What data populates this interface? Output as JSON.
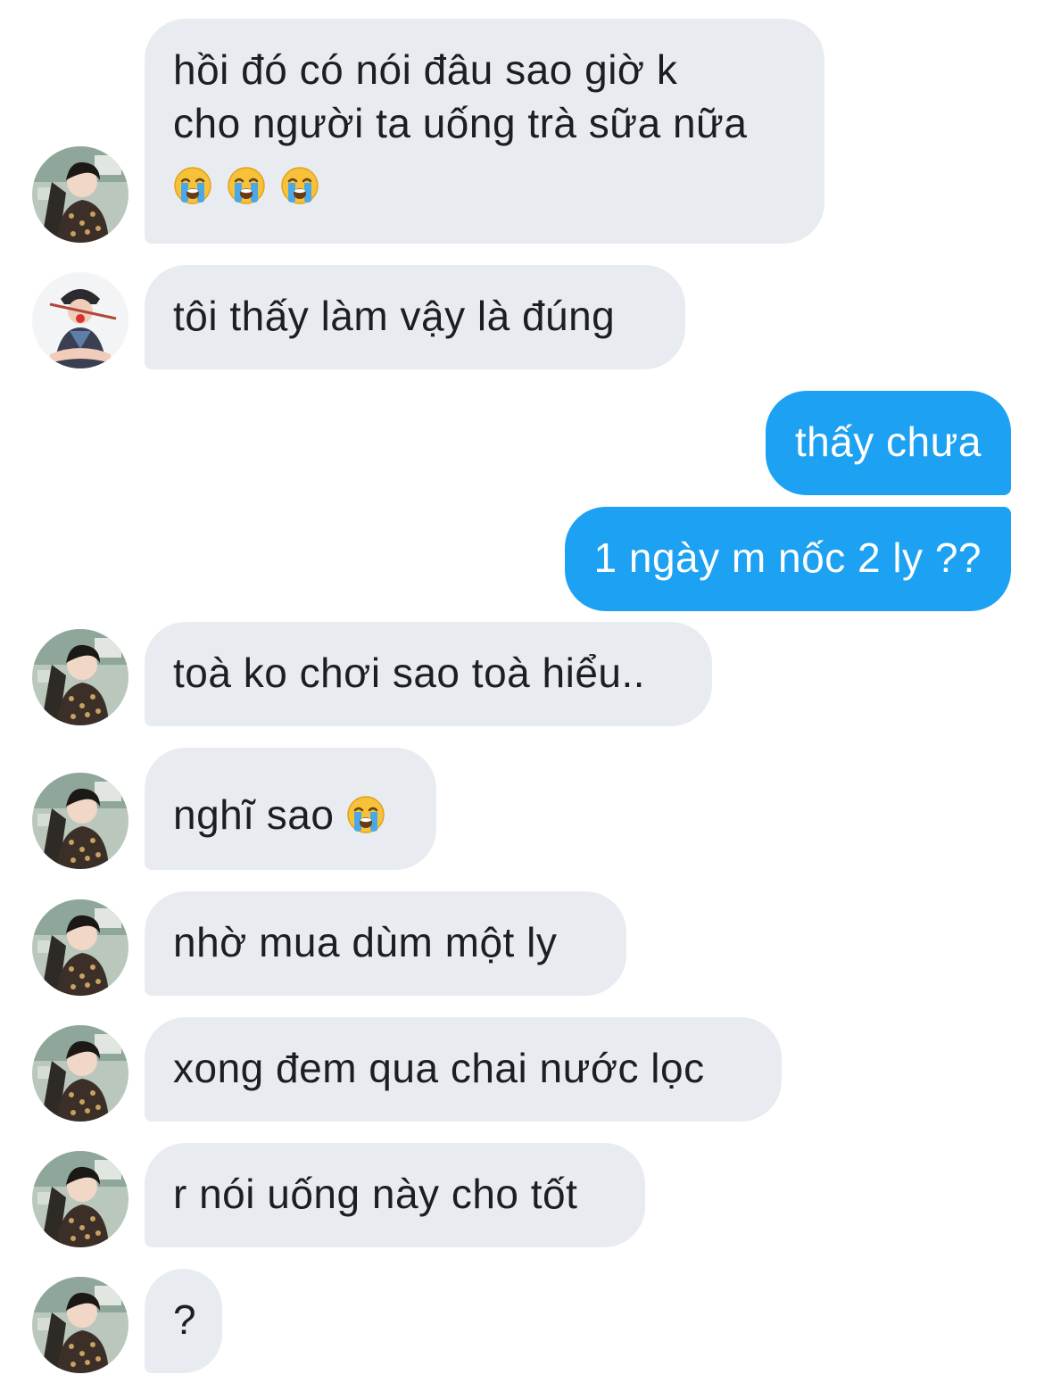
{
  "messages": [
    {
      "id": "m1",
      "side": "in",
      "lines": [
        "hồi đó có nói đâu sao giờ k",
        "cho người ta uống trà sữa nữa"
      ],
      "emoji_count": 3,
      "emoji": "loudly-crying-face",
      "avatar": "avatar-user-a"
    },
    {
      "id": "m2",
      "side": "in",
      "text": "tôi thấy làm vậy là đúng",
      "avatar": "avatar-user-b"
    },
    {
      "id": "m3",
      "side": "out",
      "text": "thấy chưa"
    },
    {
      "id": "m4",
      "side": "out",
      "text": "1 ngày m nốc 2 ly ??"
    },
    {
      "id": "m5",
      "side": "in",
      "text": "toà ko chơi sao toà hiểu..",
      "avatar": "avatar-user-a"
    },
    {
      "id": "m6",
      "side": "in",
      "text": "nghĩ sao",
      "emoji": "loudly-crying-face",
      "avatar": "avatar-user-a"
    },
    {
      "id": "m7",
      "side": "in",
      "text": "nhờ mua dùm một ly",
      "avatar": "avatar-user-a"
    },
    {
      "id": "m8",
      "side": "in",
      "text": "xong đem qua chai nước lọc",
      "avatar": "avatar-user-a"
    },
    {
      "id": "m9",
      "side": "in",
      "text": "r nói uống này cho tốt",
      "avatar": "avatar-user-a"
    },
    {
      "id": "m10",
      "side": "in",
      "text": "?",
      "avatar": "avatar-user-a"
    }
  ],
  "colors": {
    "incoming_bubble": "#e8ecf0",
    "outgoing_bubble": "#1da1f2",
    "incoming_text": "#1c1e21",
    "outgoing_text": "#ffffff"
  }
}
